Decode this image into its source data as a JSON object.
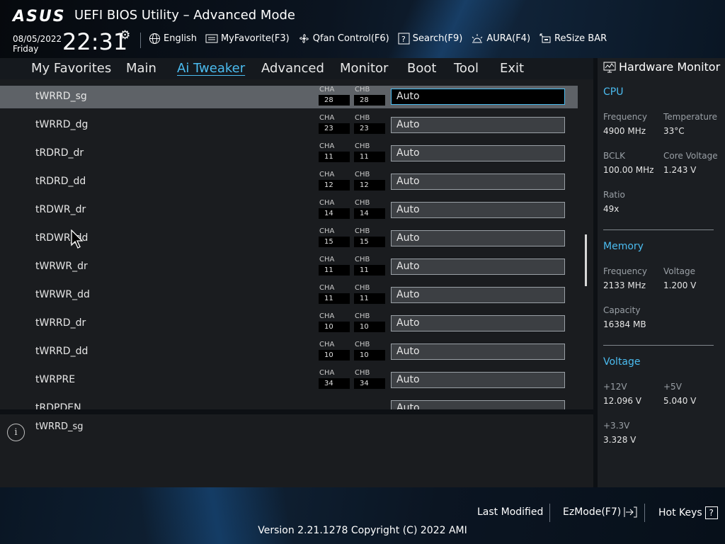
{
  "header": {
    "logo": "ASUS",
    "title": "UEFI BIOS Utility – Advanced Mode",
    "date": "08/05/2022",
    "day": "Friday",
    "time": "22:31"
  },
  "toolbar": {
    "language": "English",
    "myfavorite": "MyFavorite(F3)",
    "qfan": "Qfan Control(F6)",
    "search": "Search(F9)",
    "aura": "AURA(F4)",
    "resizebar": "ReSize BAR"
  },
  "nav": {
    "tabs": [
      "My Favorites",
      "Main",
      "Ai Tweaker",
      "Advanced",
      "Monitor",
      "Boot",
      "Tool",
      "Exit"
    ],
    "active": "Ai Tweaker"
  },
  "rows": [
    {
      "label": "tWRRD_sg",
      "cha_label": "CHA",
      "chb_label": "CHB",
      "cha": "28",
      "chb": "28",
      "value": "Auto"
    },
    {
      "label": "tWRRD_dg",
      "cha_label": "CHA",
      "chb_label": "CHB",
      "cha": "23",
      "chb": "23",
      "value": "Auto"
    },
    {
      "label": "tRDRD_dr",
      "cha_label": "CHA",
      "chb_label": "CHB",
      "cha": "11",
      "chb": "11",
      "value": "Auto"
    },
    {
      "label": "tRDRD_dd",
      "cha_label": "CHA",
      "chb_label": "CHB",
      "cha": "12",
      "chb": "12",
      "value": "Auto"
    },
    {
      "label": "tRDWR_dr",
      "cha_label": "CHA",
      "chb_label": "CHB",
      "cha": "14",
      "chb": "14",
      "value": "Auto"
    },
    {
      "label": "tRDWR_dd",
      "cha_label": "CHA",
      "chb_label": "CHB",
      "cha": "15",
      "chb": "15",
      "value": "Auto"
    },
    {
      "label": "tWRWR_dr",
      "cha_label": "CHA",
      "chb_label": "CHB",
      "cha": "11",
      "chb": "11",
      "value": "Auto"
    },
    {
      "label": "tWRWR_dd",
      "cha_label": "CHA",
      "chb_label": "CHB",
      "cha": "11",
      "chb": "11",
      "value": "Auto"
    },
    {
      "label": "tWRRD_dr",
      "cha_label": "CHA",
      "chb_label": "CHB",
      "cha": "10",
      "chb": "10",
      "value": "Auto"
    },
    {
      "label": "tWRRD_dd",
      "cha_label": "CHA",
      "chb_label": "CHB",
      "cha": "10",
      "chb": "10",
      "value": "Auto"
    },
    {
      "label": "tWRPRE",
      "cha_label": "CHA",
      "chb_label": "CHB",
      "cha": "34",
      "chb": "34",
      "value": "Auto"
    },
    {
      "label": "tRDPDEN",
      "cha_label": "",
      "chb_label": "",
      "cha": "",
      "chb": "",
      "value": "Auto"
    }
  ],
  "help": {
    "text": "tWRRD_sg"
  },
  "hw": {
    "title": "Hardware Monitor",
    "cpu": {
      "heading": "CPU",
      "frequency_label": "Frequency",
      "frequency": "4900 MHz",
      "temperature_label": "Temperature",
      "temperature": "33°C",
      "bclk_label": "BCLK",
      "bclk": "100.00 MHz",
      "core_voltage_label": "Core Voltage",
      "core_voltage": "1.243 V",
      "ratio_label": "Ratio",
      "ratio": "49x"
    },
    "memory": {
      "heading": "Memory",
      "frequency_label": "Frequency",
      "frequency": "2133 MHz",
      "voltage_label": "Voltage",
      "voltage": "1.200 V",
      "capacity_label": "Capacity",
      "capacity": "16384 MB"
    },
    "voltage": {
      "heading": "Voltage",
      "v12_label": "+12V",
      "v12": "12.096 V",
      "v5_label": "+5V",
      "v5": "5.040 V",
      "v33_label": "+3.3V",
      "v33": "3.328 V"
    }
  },
  "footer": {
    "last_modified": "Last Modified",
    "ezmode": "EzMode(F7)",
    "hotkeys": "Hot Keys",
    "hotkeys_key": "?",
    "version": "Version 2.21.1278 Copyright (C) 2022 AMI"
  },
  "colors": {
    "accent": "#4bbcf0",
    "selected_row": "#5e6267",
    "panel": "#1a1c1f"
  }
}
